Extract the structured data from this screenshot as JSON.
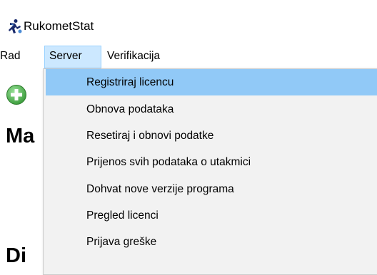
{
  "window": {
    "title": "RukometStat",
    "icon": "handball-player-icon"
  },
  "menubar": {
    "items": [
      {
        "label": "Rad"
      },
      {
        "label": "Server",
        "active": true
      },
      {
        "label": "Verifikacija"
      }
    ]
  },
  "content": {
    "add_icon": "add-circle-icon",
    "label_1": "Ma",
    "label_2": "Di"
  },
  "server_menu": {
    "items": [
      {
        "label": "Registriraj licencu",
        "highlighted": true
      },
      {
        "label": "Obnova podataka"
      },
      {
        "label": "Resetiraj i obnovi podatke"
      },
      {
        "label": "Prijenos svih podataka o utakmici"
      },
      {
        "label": "Dohvat nove verzije programa"
      },
      {
        "label": "Pregled licenci"
      },
      {
        "label": "Prijava greške"
      }
    ]
  },
  "colors": {
    "menu_active_bg": "#cce8ff",
    "menu_item_highlight": "#91c9f7",
    "dropdown_bg": "#f2f2f2",
    "add_icon_green": "#5cb85c"
  }
}
